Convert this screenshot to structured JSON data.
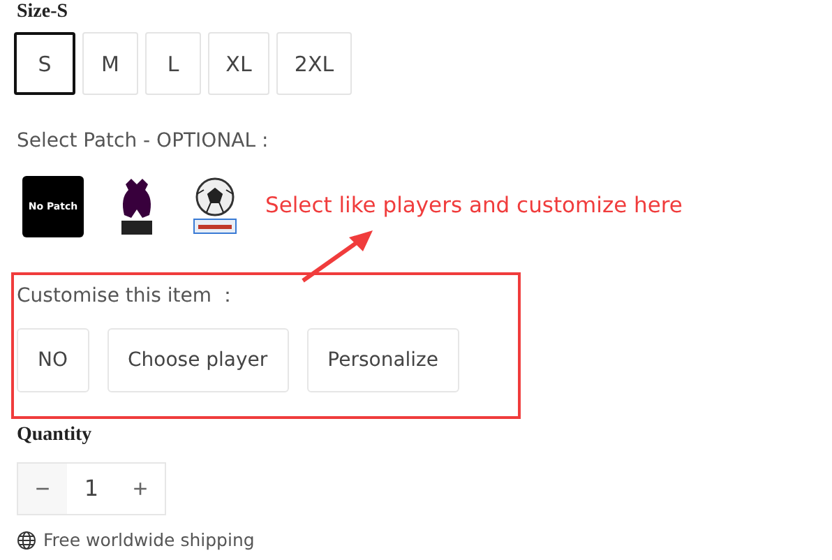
{
  "size": {
    "label": "Size-S",
    "options": [
      {
        "label": "S",
        "selected": true
      },
      {
        "label": "M",
        "selected": false
      },
      {
        "label": "L",
        "selected": false
      },
      {
        "label": "XL",
        "selected": false
      },
      {
        "label": "2XL",
        "selected": false
      }
    ]
  },
  "patch": {
    "label": "Select Patch - OPTIONAL :",
    "options": [
      {
        "kind": "text",
        "label": "No Patch"
      },
      {
        "kind": "league"
      },
      {
        "kind": "ball"
      }
    ]
  },
  "annotation": {
    "text": "Select like players and customize here"
  },
  "customise": {
    "label": "Customise this item ：",
    "options": [
      {
        "label": "NO"
      },
      {
        "label": "Choose player"
      },
      {
        "label": "Personalize"
      }
    ]
  },
  "quantity": {
    "label": "Quantity",
    "minus": "−",
    "value": "1",
    "plus": "+"
  },
  "shipping": {
    "text": "Free worldwide shipping"
  }
}
